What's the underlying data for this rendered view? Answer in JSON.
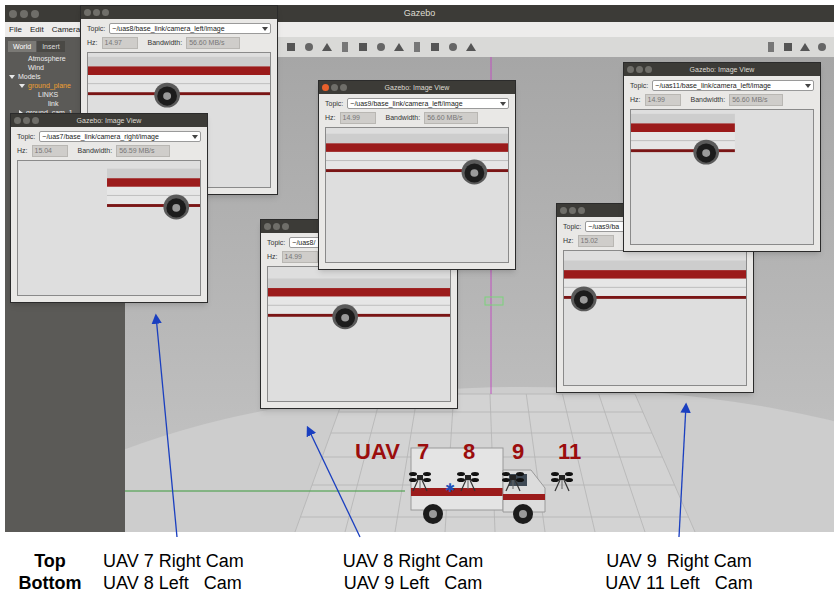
{
  "window": {
    "title": "Gazebo"
  },
  "menu": [
    "File",
    "Edit",
    "Camera"
  ],
  "sidebar": {
    "tabs": [
      {
        "label": "World",
        "selected": true
      },
      {
        "label": "Insert",
        "selected": false
      }
    ],
    "tree": [
      {
        "label": "Atmosphere",
        "depth": 1,
        "kind": "leaf",
        "expanded": false,
        "selected": false
      },
      {
        "label": "Wind",
        "depth": 1,
        "kind": "leaf",
        "expanded": false,
        "selected": false
      },
      {
        "label": "Models",
        "depth": 0,
        "kind": "group",
        "expanded": true,
        "selected": false
      },
      {
        "label": "ground_plane",
        "depth": 1,
        "kind": "group",
        "expanded": true,
        "selected": true
      },
      {
        "label": "LINKS",
        "depth": 2,
        "kind": "leaf",
        "expanded": false,
        "selected": false
      },
      {
        "label": "link",
        "depth": 3,
        "kind": "leaf",
        "expanded": false,
        "selected": false
      },
      {
        "label": "ground_cam_1",
        "depth": 1,
        "kind": "group",
        "expanded": false,
        "selected": false
      }
    ]
  },
  "image_view_labels": {
    "topic": "Topic:",
    "hz": "Hz:",
    "bandwidth": "Bandwidth:"
  },
  "image_views": [
    {
      "topic": "~/uas8/base_link/camera_left/image",
      "hz": "14.97",
      "bandwidth": "56.60 MB/s",
      "focused": false
    },
    {
      "title": "Gazebo: Image View",
      "topic": "~/uas7/base_link/camera_right/image",
      "hz": "15.04",
      "bandwidth": "56.59 MB/s",
      "focused": false
    },
    {
      "topic": "~/uas8/",
      "hz": "14.99",
      "focused": false
    },
    {
      "title": "Gazebo: Image View",
      "topic": "~/uas9/base_link/camera_left/image",
      "hz": "14.99",
      "bandwidth": "56.60 MB/s",
      "focused": true
    },
    {
      "topic": "~/uas9/ba",
      "hz": "15.02",
      "focused": false
    },
    {
      "title": "Gazebo: Image View",
      "topic": "~/uas11/base_link/camera_left/image",
      "hz": "14.99",
      "bandwidth": "56.60 MB/s",
      "focused": false
    }
  ],
  "scene": {
    "labels": [
      "UAV",
      "7",
      "8",
      "9",
      "11"
    ]
  },
  "captions": {
    "row_labels": [
      "Top",
      "Bottom"
    ],
    "columns": [
      {
        "top": "UAV 7 Right Cam",
        "bottom": "UAV 8 Left   Cam"
      },
      {
        "top": "UAV 8 Right Cam",
        "bottom": "UAV 9 Left   Cam"
      },
      {
        "top": "UAV 9  Right Cam",
        "bottom": "UAV 11 Left   Cam"
      }
    ]
  }
}
